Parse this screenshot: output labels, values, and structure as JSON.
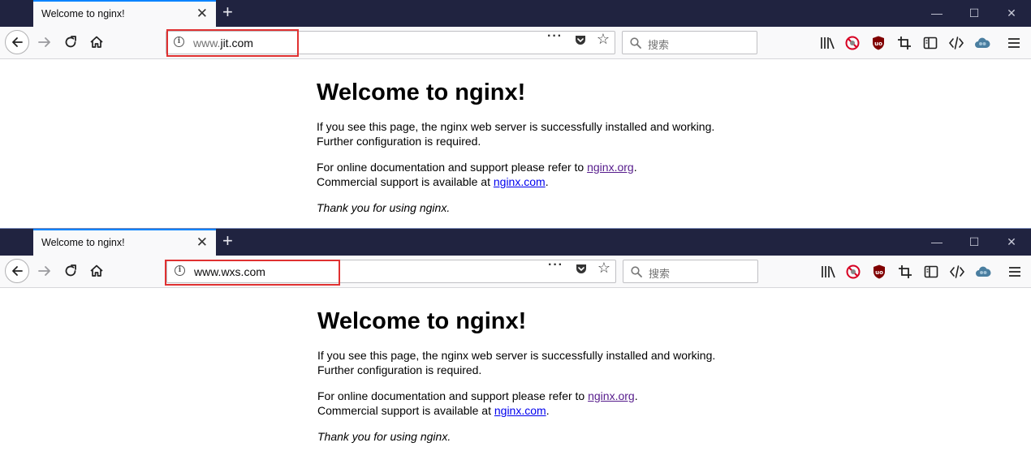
{
  "windows": [
    {
      "tab_title": "Welcome to nginx!",
      "url": "www.jit.com",
      "url_host_prefix": "www.",
      "url_host_main": "jit.com",
      "search_placeholder": "搜索",
      "page": {
        "heading": "Welcome to nginx!",
        "p1_line1": "If you see this page, the nginx web server is successfully installed and working.",
        "p1_line2": "Further configuration is required.",
        "p2_line1_before": "For online documentation and support please refer to ",
        "p2_link1": "nginx.org",
        "p2_line1_after": ".",
        "p2_line2_before": "Commercial support is available at ",
        "p2_link2": "nginx.com",
        "p2_line2_after": ".",
        "p3": "Thank you for using nginx."
      }
    },
    {
      "tab_title": "Welcome to nginx!",
      "url": "www.wxs.com",
      "search_placeholder": "搜索",
      "page": {
        "heading": "Welcome to nginx!",
        "p1_line1": "If you see this page, the nginx web server is successfully installed and working.",
        "p1_line2": "Further configuration is required.",
        "p2_line1_before": "For online documentation and support please refer to ",
        "p2_link1": "nginx.org",
        "p2_line1_after": ".",
        "p2_line2_before": "Commercial support is available at ",
        "p2_link2": "nginx.com",
        "p2_line2_after": ".",
        "p3": "Thank you for using nginx."
      }
    }
  ],
  "colors": {
    "titlebar": "#202340",
    "tab_accent": "#0a84ff",
    "highlight_box": "#e03131",
    "link": "#0000ee",
    "visited_link": "#551a8b"
  },
  "icons": {
    "back": "arrow-left-icon",
    "forward": "arrow-right-icon",
    "reload": "reload-icon",
    "home": "home-icon",
    "info": "info-icon",
    "page_actions": "more-dots-icon",
    "pocket": "pocket-icon",
    "bookmark": "star-icon",
    "search": "search-icon",
    "library": "library-icon",
    "tracking_block": "blocked-icon",
    "ublock": "ublock-icon",
    "screenshot": "crop-icon",
    "sidebar": "sidebar-icon",
    "devtools": "code-icon",
    "sync": "cloud-icon",
    "menu": "hamburger-icon",
    "new_tab": "plus-icon",
    "tab_close": "close-icon",
    "minimize": "minimize-icon",
    "maximize": "maximize-icon",
    "close_window": "close-icon"
  }
}
